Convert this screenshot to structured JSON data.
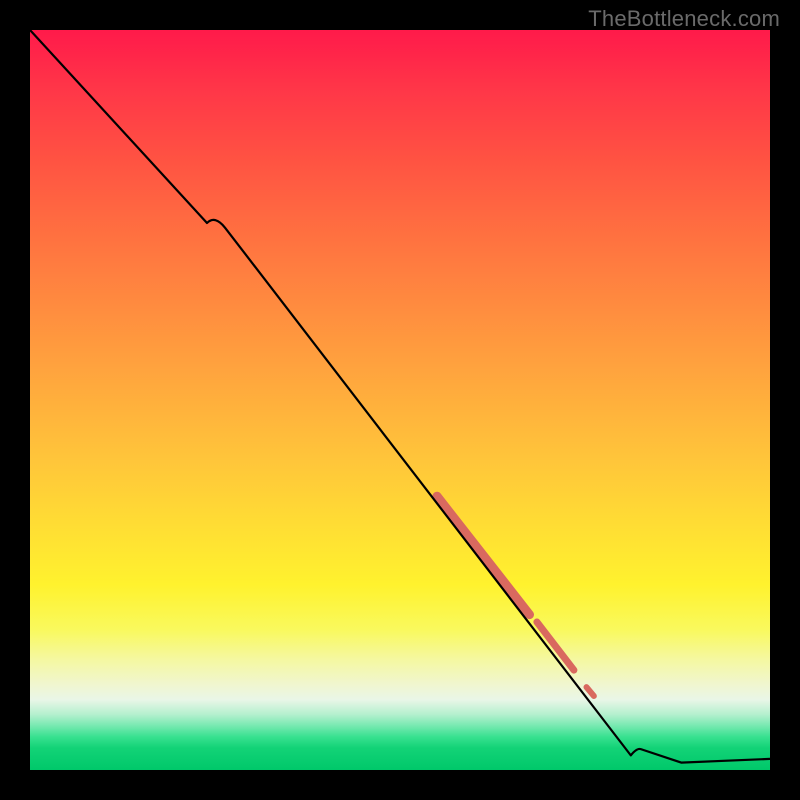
{
  "watermark": "TheBottleneck.com",
  "chart_data": {
    "type": "line",
    "title": "",
    "xlabel": "",
    "ylabel": "",
    "xlim": [
      0,
      100
    ],
    "ylim": [
      0,
      100
    ],
    "line": {
      "x": [
        0,
        25,
        82,
        88,
        100
      ],
      "y": [
        100,
        75,
        3,
        1,
        1.5
      ]
    },
    "highlight_segments": [
      {
        "x": [
          55,
          67.5
        ],
        "y": [
          37,
          21
        ],
        "width": 9
      },
      {
        "x": [
          68.5,
          73.5
        ],
        "y": [
          20,
          13.5
        ],
        "width": 7
      },
      {
        "x": [
          75.2,
          76.2
        ],
        "y": [
          11.2,
          10
        ],
        "width": 6
      }
    ],
    "colors": {
      "line": "#000000",
      "highlight": "#d9695f"
    }
  }
}
